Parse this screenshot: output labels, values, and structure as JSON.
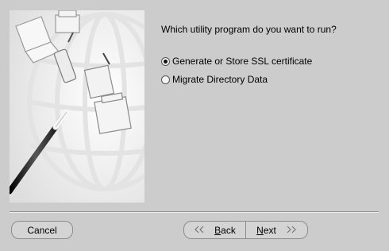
{
  "prompt": {
    "question": "Which utility program do you want to run?"
  },
  "options": [
    {
      "label": "Generate or Store SSL certificate",
      "selected": true
    },
    {
      "label": "Migrate Directory Data",
      "selected": false
    }
  ],
  "buttons": {
    "cancel_label": "Cancel",
    "back_label": "Back",
    "next_label": "Next"
  },
  "icons": {
    "back": "double-chevron-left-icon",
    "next": "double-chevron-right-icon"
  }
}
